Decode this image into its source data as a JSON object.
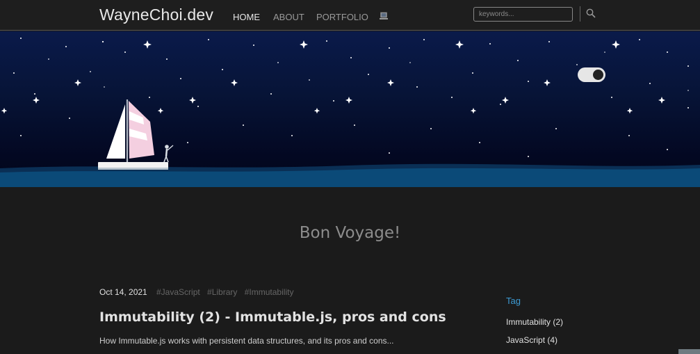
{
  "navbar": {
    "brand": "WayneChoi.dev",
    "links": [
      {
        "label": "HOME",
        "active": true
      },
      {
        "label": "ABOUT",
        "active": false
      },
      {
        "label": "PORTFOLIO",
        "active": false
      }
    ],
    "laptop_icon": "laptop-icon",
    "search": {
      "placeholder": "keywords...",
      "value": "",
      "icon": "search-icon"
    }
  },
  "hero": {
    "theme_toggle": {
      "state": "dark"
    },
    "colors": {
      "sky_top": "#0a1a4a",
      "sky_bottom": "#02061a",
      "sea": "#0b4a78",
      "sail_pink": "#f4cfe0"
    }
  },
  "main": {
    "tagline": "Bon Voyage!",
    "post": {
      "date": "Oct 14, 2021",
      "tags": [
        "#JavaScript",
        "#Library",
        "#Immutability"
      ],
      "title": "Immutability (2) - Immutable.js, pros and cons",
      "excerpt": "How Immutable.js works with persistent data structures, and its pros and cons..."
    }
  },
  "sidebar": {
    "heading": "Tag",
    "items": [
      {
        "label": "Immutability (2)"
      },
      {
        "label": "JavaScript (4)"
      }
    ]
  },
  "colors": {
    "background": "#1b1b1b",
    "accent": "#3d9bd4"
  }
}
